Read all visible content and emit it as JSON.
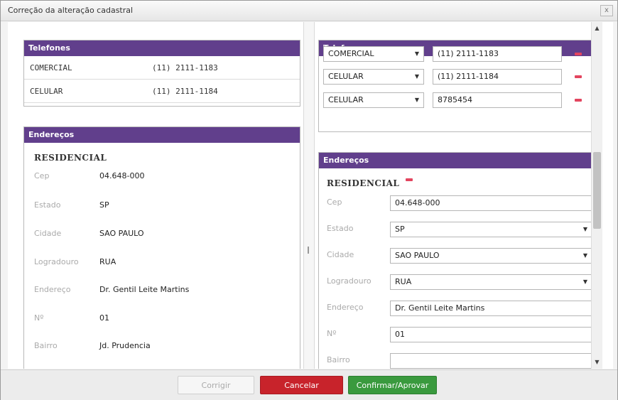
{
  "dialog": {
    "title": "Correção da alteração cadastral",
    "close_label": "x"
  },
  "left": {
    "phones_header": "Telefones",
    "phones": [
      {
        "type": "COMERCIAL",
        "number": "(11) 2111-1183"
      },
      {
        "type": "CELULAR",
        "number": "(11) 2111-1184"
      }
    ],
    "address_header": "Endereços",
    "address_type": "RESIDENCIAL",
    "fields": [
      {
        "label": "Cep",
        "value": "04.648-000"
      },
      {
        "label": "Estado",
        "value": "SP"
      },
      {
        "label": "Cidade",
        "value": "SAO PAULO"
      },
      {
        "label": "Logradouro",
        "value": "RUA"
      },
      {
        "label": "Endereço",
        "value": "Dr. Gentil Leite Martins"
      },
      {
        "label": "Nº",
        "value": "01"
      },
      {
        "label": "Bairro",
        "value": "Jd. Prudencia"
      }
    ]
  },
  "right": {
    "phones_header": "Telefones",
    "phones": [
      {
        "type": "COMERCIAL",
        "number": "(11) 2111-1183"
      },
      {
        "type": "CELULAR",
        "number": "(11) 2111-1184"
      },
      {
        "type": "CELULAR",
        "number": "8785454"
      }
    ],
    "address_header": "Endereços",
    "address_type": "RESIDENCIAL",
    "fields": [
      {
        "label": "Cep",
        "value": "04.648-000"
      },
      {
        "label": "Estado",
        "value": "SP"
      },
      {
        "label": "Cidade",
        "value": "SAO PAULO"
      },
      {
        "label": "Logradouro",
        "value": "RUA"
      },
      {
        "label": "Endereço",
        "value": "Dr. Gentil Leite Martins"
      },
      {
        "label": "Nº",
        "value": "01"
      },
      {
        "label": "Bairro",
        "value": ""
      }
    ]
  },
  "footer": {
    "corrigir": "Corrigir",
    "cancelar": "Cancelar",
    "confirmar": "Confirmar/Aprovar"
  },
  "colors": {
    "header": "#613f8c",
    "cancel": "#c8232b",
    "confirm": "#3a9a3e",
    "remove": "#e3455f"
  }
}
